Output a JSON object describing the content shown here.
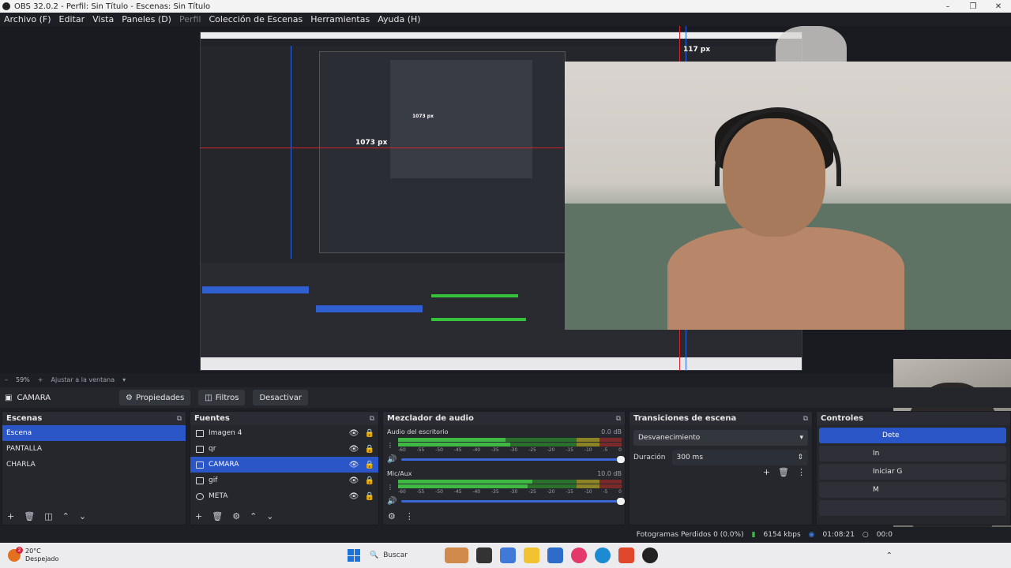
{
  "window": {
    "title": "OBS 32.0.2 - Perfil: Sin Título - Escenas: Sin Título"
  },
  "menu": [
    "Archivo (F)",
    "Editar",
    "Vista",
    "Paneles (D)",
    "Perfil",
    "Colección de Escenas",
    "Herramientas",
    "Ayuda (H)"
  ],
  "preview": {
    "measure_large": "1073 px",
    "measure_small": "117 px",
    "measure_inner": "1073 px"
  },
  "zoom": {
    "value": "59%",
    "fit_label": "Ajustar a la ventana"
  },
  "context_bar": {
    "source_name": "CAMARA",
    "properties_label": "Propiedades",
    "filters_label": "Filtros",
    "deactivate_label": "Desactivar"
  },
  "scenes": {
    "title": "Escenas",
    "items": [
      "Escena",
      "PANTALLA",
      "CHARLA"
    ],
    "selected": "Escena"
  },
  "sources": {
    "title": "Fuentes",
    "items": [
      "Imagen 4",
      "qr",
      "CAMARA",
      "gif",
      "META"
    ],
    "selected": "CAMARA"
  },
  "mixer": {
    "title": "Mezclador de audio",
    "channels": [
      {
        "name": "Audio del escritorio",
        "db": "0.0 dB"
      },
      {
        "name": "Mic/Aux",
        "db": "10.0 dB"
      }
    ],
    "ticks": [
      "-60",
      "-55",
      "-50",
      "-45",
      "-40",
      "-35",
      "-30",
      "-25",
      "-20",
      "-15",
      "-10",
      "-5",
      "0"
    ]
  },
  "transitions": {
    "title": "Transiciones de escena",
    "selected": "Desvanecimiento",
    "duration_label": "Duración",
    "duration_value": "300 ms"
  },
  "controls": {
    "title": "Controles",
    "buttons": [
      "Dete",
      "In",
      "Iniciar G",
      "M",
      ""
    ]
  },
  "status": {
    "dropped_frames": "Fotogramas Perdidos 0 (0.0%)",
    "bitrate": "6154 kbps",
    "stream_time": "01:08:21",
    "rec_time": "00:0"
  },
  "taskbar": {
    "temperature": "20°C",
    "condition": "Despejado",
    "search_placeholder": "Buscar",
    "weather_badge": "2"
  },
  "colors": {
    "accent": "#2b56c8",
    "meter_green": "#3fb944",
    "guide_red": "#d9222a",
    "guide_blue": "#2f66e0"
  }
}
